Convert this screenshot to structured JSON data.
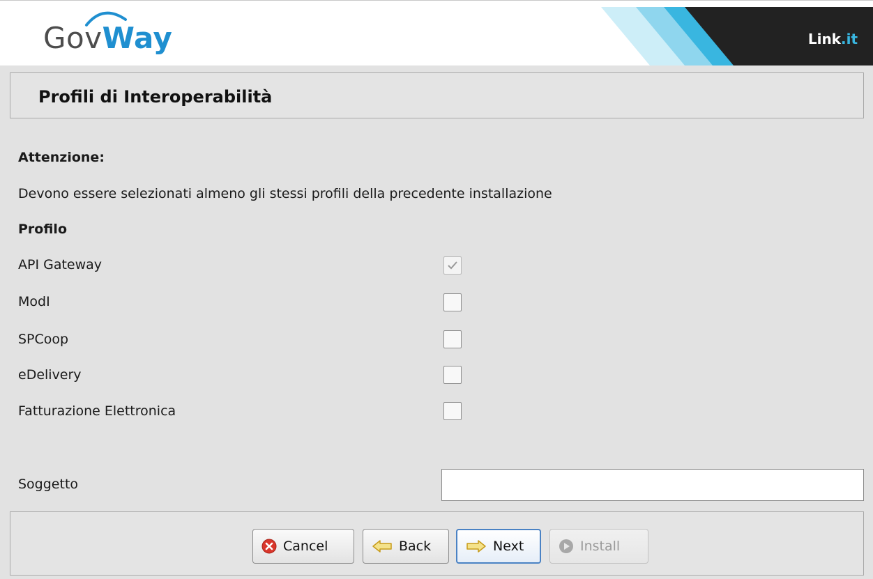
{
  "header": {
    "logo_gov": "Gov",
    "logo_way": "Way",
    "brand_main": "Link",
    "brand_dot": ".it"
  },
  "page": {
    "title": "Profili di Interoperabilità"
  },
  "notice": {
    "heading": "Attenzione:",
    "message": "Devono essere selezionati almeno gli stessi profili della precedente installazione"
  },
  "profiles": {
    "heading": "Profilo",
    "items": [
      {
        "label": "API Gateway",
        "checked": true,
        "enabled": false
      },
      {
        "label": "ModI",
        "checked": false,
        "enabled": true
      },
      {
        "label": "SPCoop",
        "checked": false,
        "enabled": true
      },
      {
        "label": "eDelivery",
        "checked": false,
        "enabled": true
      },
      {
        "label": "Fatturazione Elettronica",
        "checked": false,
        "enabled": true
      }
    ]
  },
  "soggetto": {
    "label": "Soggetto",
    "value": ""
  },
  "buttons": {
    "cancel": "Cancel",
    "back": "Back",
    "next": "Next",
    "install": "Install"
  },
  "icons": {
    "cancel": "cancel-icon",
    "back": "arrow-left-icon",
    "next": "arrow-right-icon",
    "install": "install-icon"
  },
  "colors": {
    "brand_blue": "#1f8fd0",
    "header_dark": "#222222",
    "accent_cyan": "#39b6e0",
    "cancel_red": "#d9362b",
    "arrow_yellow": "#f4c542",
    "focus_blue": "#4a82c4"
  }
}
